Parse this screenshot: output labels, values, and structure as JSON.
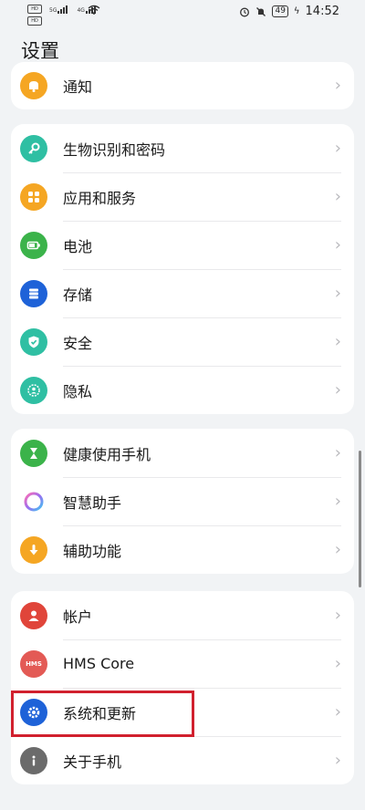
{
  "status_bar": {
    "sim1": "HD",
    "sim2": "HD",
    "network1": "5G",
    "network2": "4G",
    "battery": "49",
    "time": "14:52"
  },
  "title": "设置",
  "groups": [
    {
      "items": [
        {
          "label": "通知",
          "icon": "bell-icon",
          "color": "#f5a623"
        }
      ]
    },
    {
      "items": [
        {
          "label": "生物识别和密码",
          "icon": "key-icon",
          "color": "#2fbfa3"
        },
        {
          "label": "应用和服务",
          "icon": "apps-grid-icon",
          "color": "#f5a623"
        },
        {
          "label": "电池",
          "icon": "battery-icon",
          "color": "#3bb34a"
        },
        {
          "label": "存储",
          "icon": "storage-icon",
          "color": "#1e62d8"
        },
        {
          "label": "安全",
          "icon": "shield-icon",
          "color": "#2fbfa3"
        },
        {
          "label": "隐私",
          "icon": "privacy-icon",
          "color": "#2fbfa3"
        }
      ]
    },
    {
      "items": [
        {
          "label": "健康使用手机",
          "icon": "hourglass-icon",
          "color": "#3bb34a"
        },
        {
          "label": "智慧助手",
          "icon": "assistant-orb-icon",
          "color": "#9b6df0"
        },
        {
          "label": "辅助功能",
          "icon": "hand-pointer-icon",
          "color": "#f5a623"
        }
      ]
    },
    {
      "items": [
        {
          "label": "帐户",
          "icon": "account-icon",
          "color": "#e0453a"
        },
        {
          "label": "HMS Core",
          "icon": "hms-icon",
          "color": "#e35a55",
          "icon_text": "HMS"
        },
        {
          "label": "系统和更新",
          "icon": "gear-icon",
          "color": "#1e62d8"
        },
        {
          "label": "关于手机",
          "icon": "info-icon",
          "color": "#6b6b6b"
        }
      ]
    }
  ]
}
